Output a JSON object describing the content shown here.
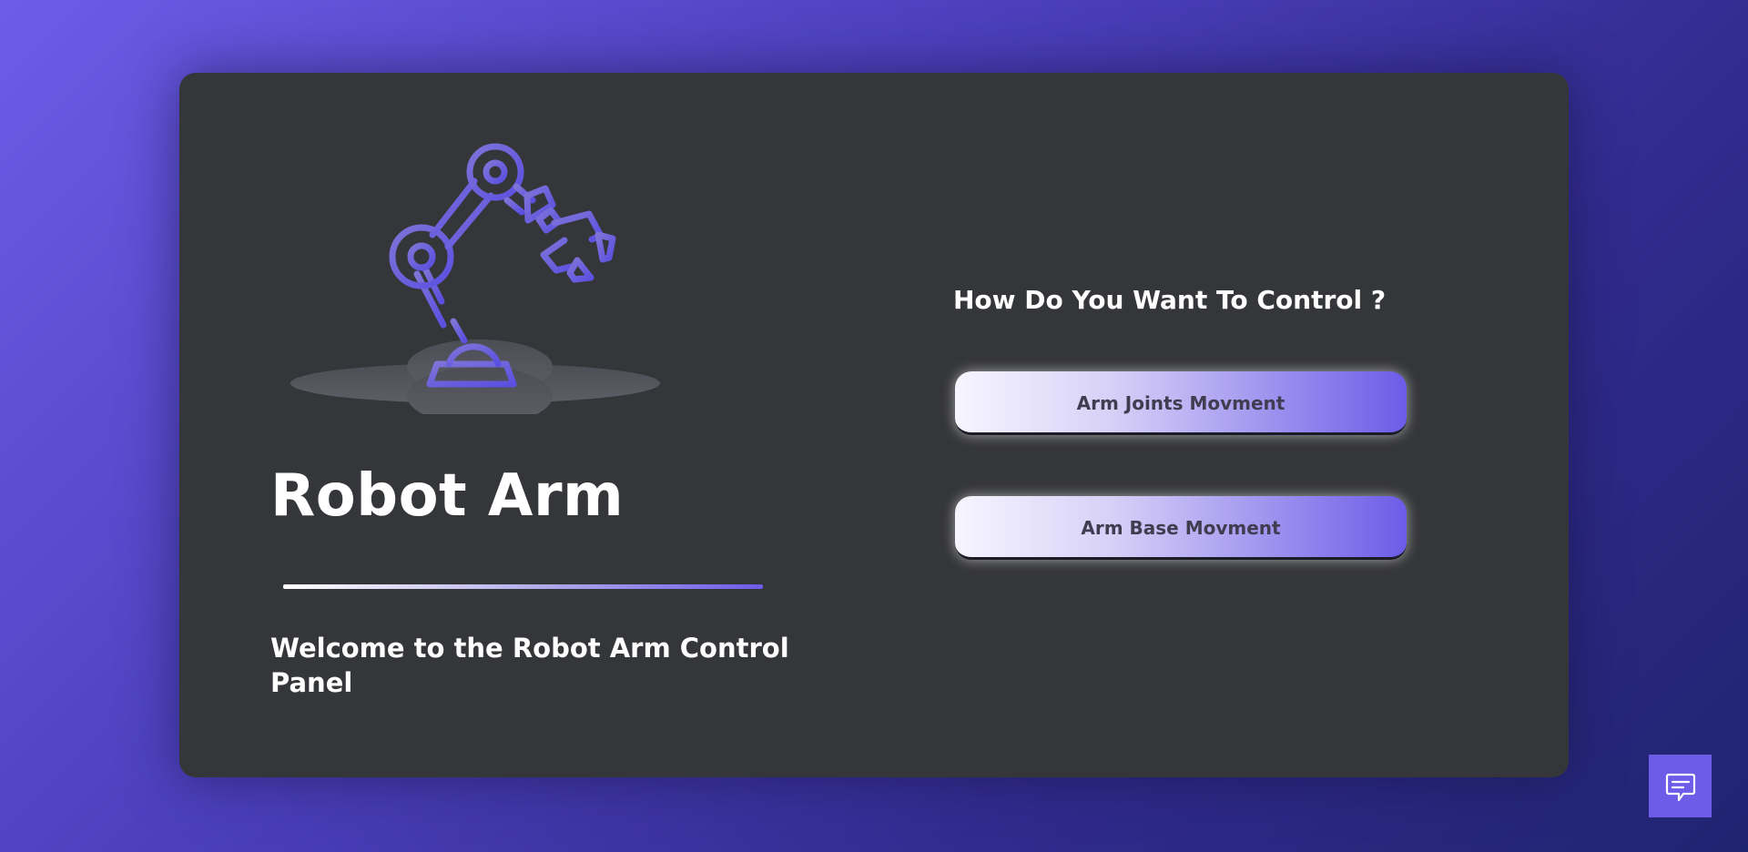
{
  "hero": {
    "title": "Robot Arm",
    "welcome": "Welcome to the Robot Arm Control Panel",
    "illustration_icon": "robot-arm-icon"
  },
  "control": {
    "question": "How Do You Want To Control ?",
    "joints_label": "Arm Joints Movment",
    "base_label": "Arm Base Movment"
  },
  "chat": {
    "icon": "chat-icon"
  },
  "colors": {
    "accent": "#6c5ce7",
    "panel": "#353639",
    "text": "#ffffff",
    "button_text": "#3f3d4f"
  }
}
